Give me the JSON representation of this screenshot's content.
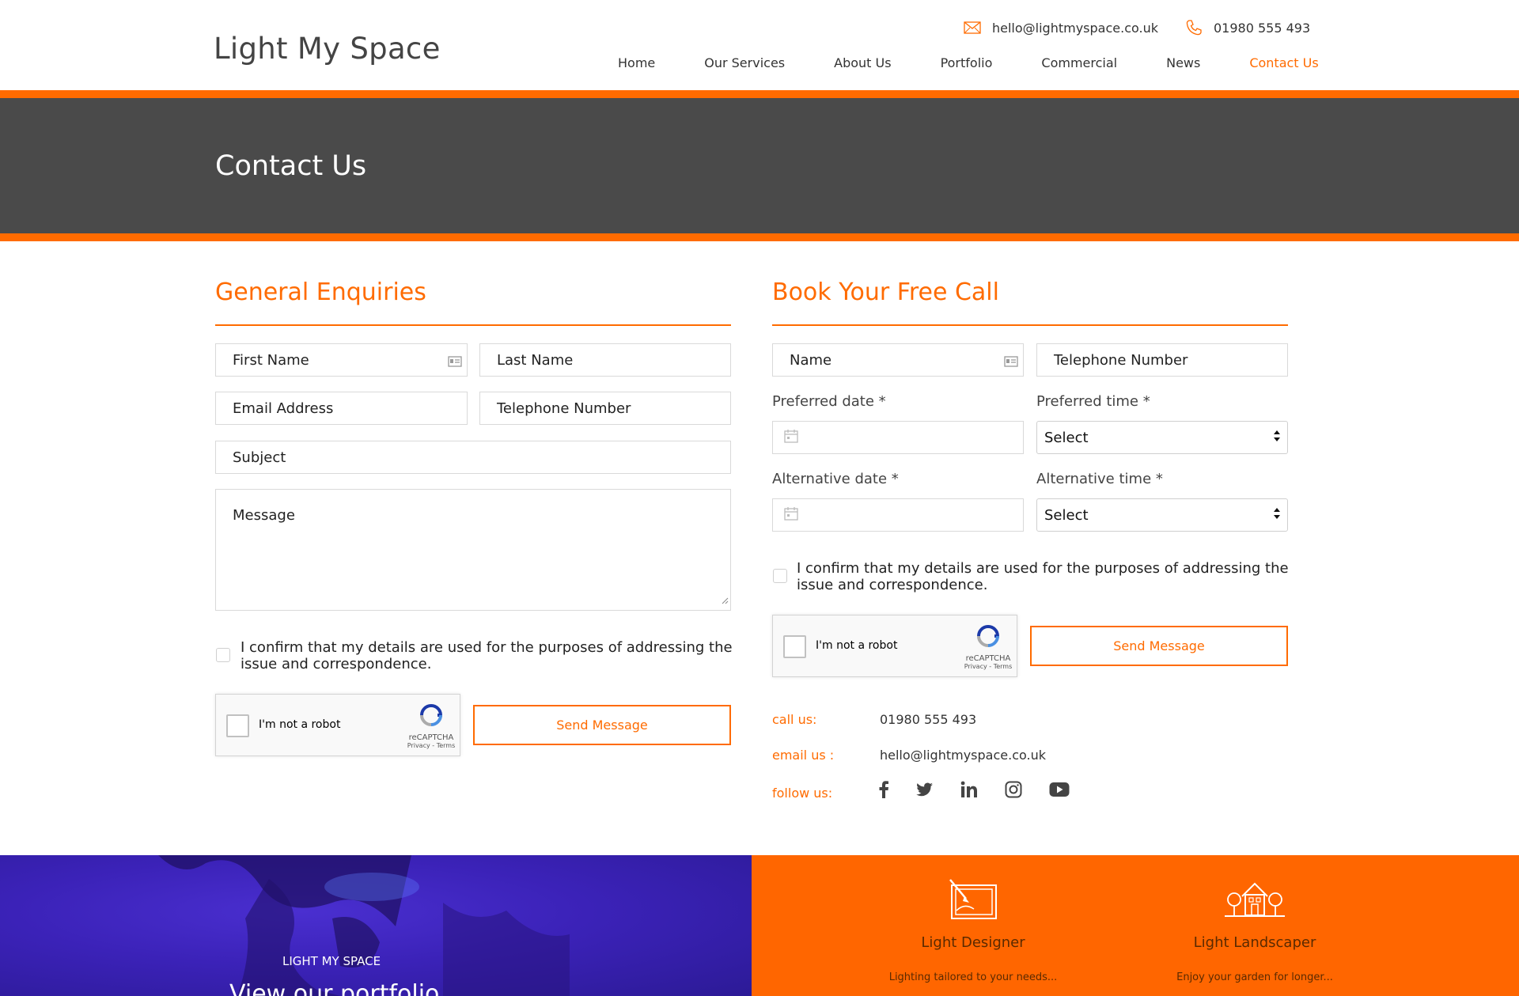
{
  "header": {
    "logo_text": "Light My Space",
    "email": "hello@lightmyspace.co.uk",
    "phone": "01980 555 493",
    "nav": [
      "Home",
      "Our Services",
      "About Us",
      "Portfolio",
      "Commercial",
      "News",
      "Contact Us"
    ],
    "active_nav": "Contact Us"
  },
  "hero": {
    "title": "Contact Us"
  },
  "general": {
    "title": "General Enquiries",
    "first_name": "First Name",
    "last_name": "Last Name",
    "email": "Email Address",
    "telephone": "Telephone Number",
    "subject": "Subject",
    "message": "Message",
    "consent": "I confirm that my details are used for the purposes of addressing the issue and correspondence.",
    "recaptcha_label": "I'm not a robot",
    "recaptcha_brand": "reCAPTCHA",
    "recaptcha_terms": "Privacy - Terms",
    "send_label": "Send Message"
  },
  "booking": {
    "title": "Book Your Free Call",
    "name": "Name",
    "telephone": "Telephone Number",
    "preferred_date_label": "Preferred date *",
    "preferred_time_label": "Preferred time *",
    "preferred_time_value": "Select",
    "alternative_date_label": "Alternative date *",
    "alternative_time_label": "Alternative time *",
    "alternative_time_value": "Select",
    "consent": "I confirm that my details are used for the purposes of addressing the issue and correspondence.",
    "recaptcha_label": "I'm not a robot",
    "recaptcha_brand": "reCAPTCHA",
    "recaptcha_terms": "Privacy - Terms",
    "send_label": "Send Message"
  },
  "contact_info": {
    "call_label": "call us:",
    "call_value": "01980 555 493",
    "email_label": "email us :",
    "email_value": "hello@lightmyspace.co.uk",
    "follow_label": "follow us:",
    "social_icons": [
      "facebook-icon",
      "twitter-icon",
      "linkedin-icon",
      "instagram-icon",
      "youtube-icon"
    ]
  },
  "bottom": {
    "brand": "LIGHT MY SPACE",
    "portfolio_heading": "View our portfolio",
    "features": [
      {
        "title": "Light Designer",
        "subtitle": "Lighting tailored to your needs..."
      },
      {
        "title": "Light Landscaper",
        "subtitle": "Enjoy your garden for longer..."
      }
    ]
  },
  "colors": {
    "accent": "#ff6b00",
    "hero_bg": "#4a4a4a",
    "text": "#333333"
  }
}
